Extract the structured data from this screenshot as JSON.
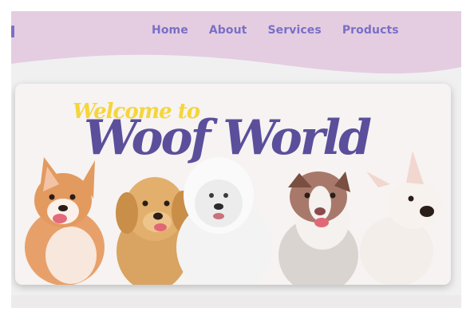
{
  "nav": {
    "items": [
      {
        "label": "Home"
      },
      {
        "label": "About"
      },
      {
        "label": "Services"
      },
      {
        "label": "Products"
      }
    ]
  },
  "hero": {
    "subtitle": "Welcome to",
    "title": "Woof World"
  },
  "colors": {
    "header_bg": "#e4cde1",
    "nav_text": "#7a6fc7",
    "title_primary": "#5b4f9b",
    "title_accent": "#f5d53a",
    "page_bg": "#f1f0f1"
  }
}
